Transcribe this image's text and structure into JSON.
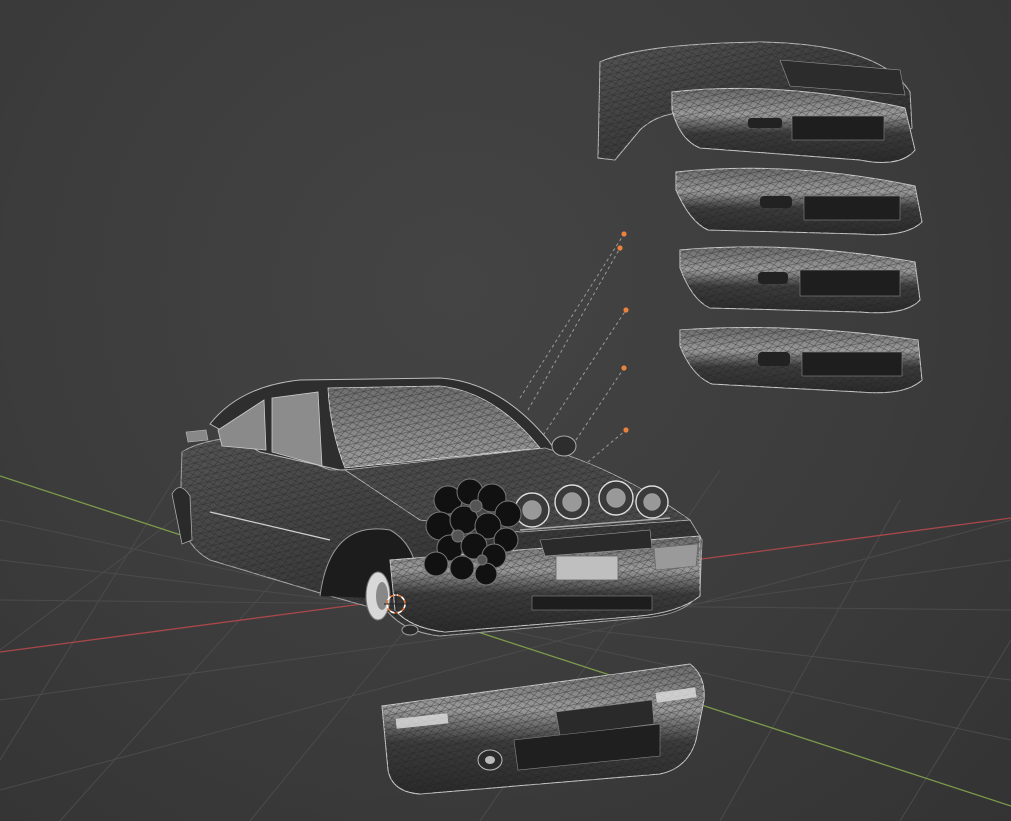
{
  "app": {
    "name": "3D viewport"
  },
  "viewport": {
    "background": "#3d3d3d",
    "grid_color": "#4a4a4a",
    "axis_x_color": "#a8474a",
    "axis_y_color": "#7b9a4a",
    "origin_color": "#e87d3e",
    "point_color": "#e8823d"
  },
  "scene": {
    "objects": [
      "car-body",
      "front-bumper-variant-1",
      "front-bumper-variant-2",
      "front-bumper-variant-3",
      "front-bumper-variant-4",
      "front-bumper-variant-5",
      "detached-bumper",
      "rally-lights",
      "spare-wheels"
    ],
    "overlays": [
      "object-origin-marker",
      "relationship-lines",
      "empty-points"
    ]
  }
}
